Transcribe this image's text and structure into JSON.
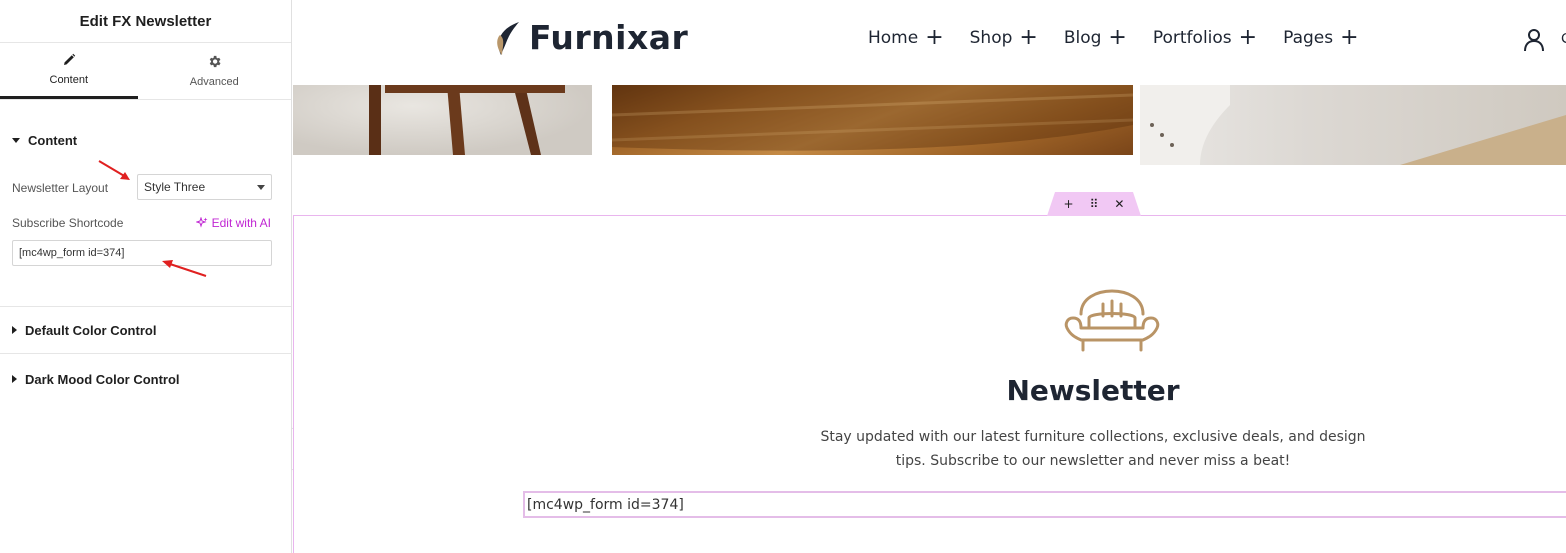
{
  "panel": {
    "title": "Edit FX Newsletter",
    "tabs": [
      {
        "label": "Content",
        "icon": "pencil-icon",
        "active": true
      },
      {
        "label": "Advanced",
        "icon": "gear-icon",
        "active": false
      }
    ],
    "sections": {
      "content": {
        "title": "Content",
        "newsletter_layout_label": "Newsletter Layout",
        "newsletter_layout_value": "Style Three",
        "subscribe_shortcode_label": "Subscribe Shortcode",
        "edit_ai_label": "Edit with AI",
        "shortcode_value": "[mc4wp_form id=374]"
      },
      "default_color": {
        "title": "Default Color Control"
      },
      "dark_mood_color": {
        "title": "Dark Mood Color Control"
      }
    },
    "collapse_glyph": "‹"
  },
  "site": {
    "logo_text": "Furnixar",
    "nav": [
      {
        "label": "Home",
        "suffix": "+"
      },
      {
        "label": "Shop",
        "suffix": "+"
      },
      {
        "label": "Blog",
        "suffix": "+"
      },
      {
        "label": "Portfolios",
        "suffix": "+"
      },
      {
        "label": "Pages",
        "suffix": "+"
      }
    ],
    "header_right_partial": "C"
  },
  "section_toolbar": {
    "add": "+",
    "drag": "⠿",
    "close": "✕"
  },
  "newsletter": {
    "title": "Newsletter",
    "description": "Stay updated with our latest furniture collections, exclusive deals, and design tips. Subscribe to our newsletter and never miss a beat!",
    "shortcode": "[mc4wp_form id=374]"
  },
  "colors": {
    "accent_ai": "#c026d3",
    "section_outline": "#e9b5ee",
    "logo_leaf": "#b9976a",
    "annotation_arrow": "#e02020"
  }
}
